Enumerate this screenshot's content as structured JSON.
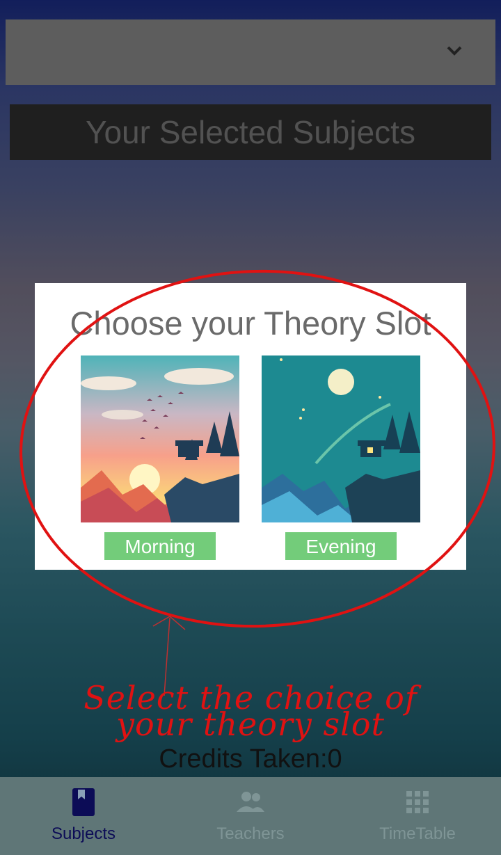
{
  "dropdown": {
    "value": "",
    "icon": "chevron-down-icon"
  },
  "section": {
    "title": "Your Selected Subjects"
  },
  "modal": {
    "title": "Choose your Theory Slot",
    "slots": [
      {
        "label": "Morning",
        "image": "sunset-landscape-image"
      },
      {
        "label": "Evening",
        "image": "night-landscape-image"
      }
    ]
  },
  "annotation": {
    "line1": "Select the choice of",
    "line2": "your theory slot"
  },
  "footer": {
    "credits": "Credits Taken:0"
  },
  "nav": {
    "items": [
      {
        "label": "Subjects",
        "icon": "book-icon",
        "active": true
      },
      {
        "label": "Teachers",
        "icon": "people-icon",
        "active": false
      },
      {
        "label": "TimeTable",
        "icon": "grid-icon",
        "active": false
      }
    ]
  },
  "colors": {
    "slot_button": "#73cc7a",
    "nav_active": "#0c0c56",
    "nav_inactive": "#7f9596",
    "annotation": "#e01212"
  }
}
